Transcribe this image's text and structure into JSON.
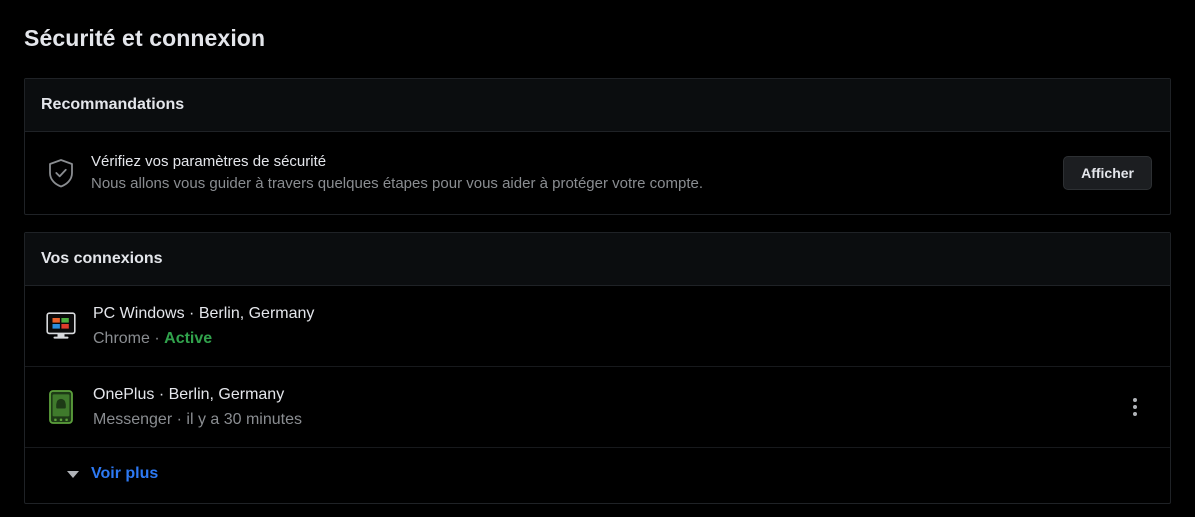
{
  "page": {
    "title": "Sécurité et connexion"
  },
  "recommendations": {
    "header": "Recommandations",
    "icon": "shield-check-icon",
    "item": {
      "title": "Vérifiez vos paramètres de sécurité",
      "description": "Nous allons vous guider à travers quelques étapes pour vous aider à protéger votre compte.",
      "button_label": "Afficher"
    }
  },
  "logins": {
    "header": "Vos connexions",
    "sessions": [
      {
        "icon": "windows-desktop-icon",
        "device": "PC Windows",
        "separator": "·",
        "location": "Berlin, Germany",
        "browser": "Chrome",
        "status": "Active",
        "status_color": "#31a24c",
        "has_menu": false
      },
      {
        "icon": "android-phone-icon",
        "device": "OnePlus",
        "separator": "·",
        "location": "Berlin, Germany",
        "browser": "Messenger",
        "status": "il y a 30 minutes",
        "status_color": "#8a8d91",
        "has_menu": true,
        "menu_icon": "three-dots-vertical-icon"
      }
    ],
    "see_more": {
      "label": "Voir plus",
      "icon": "caret-down-icon"
    }
  },
  "colors": {
    "background": "#000000",
    "card_header_bg": "#0b0d0f",
    "border": "#1f2226",
    "text_primary": "#e4e6eb",
    "text_secondary": "#8a8d91",
    "link_blue": "#2d79f3",
    "status_green": "#31a24c"
  }
}
